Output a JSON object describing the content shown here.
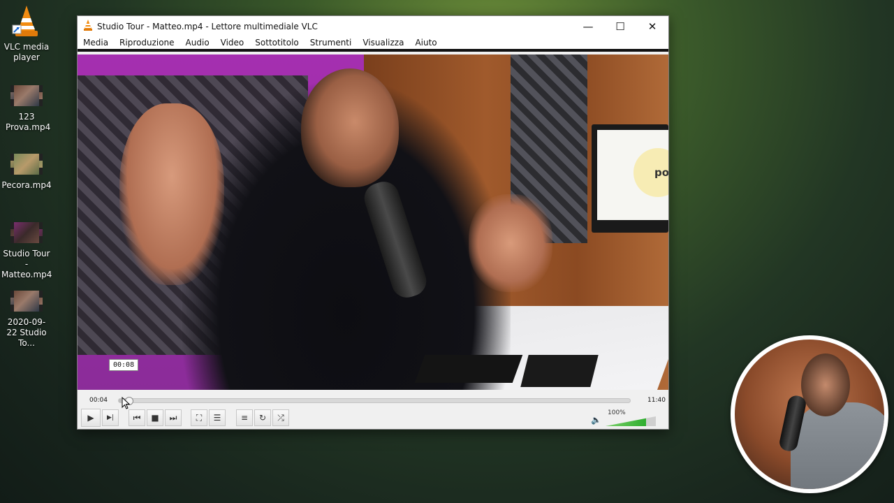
{
  "desktop": {
    "icons": [
      {
        "label": "VLC media player",
        "type": "vlc"
      },
      {
        "label": "123 Prova.mp4",
        "type": "video"
      },
      {
        "label": "Pecora.mp4",
        "type": "video"
      },
      {
        "label": "Studio Tour - Matteo.mp4",
        "type": "video"
      },
      {
        "label": "2020-09-22 Studio To...",
        "type": "video"
      }
    ]
  },
  "window": {
    "title": "Studio Tour - Matteo.mp4 - Lettore multimediale VLC",
    "minimize": "—",
    "maximize": "☐",
    "close": "✕"
  },
  "menu": [
    "Media",
    "Riproduzione",
    "Audio",
    "Video",
    "Sottotitolo",
    "Strumenti",
    "Visualizza",
    "Aiuto"
  ],
  "video": {
    "screen_text": "pod",
    "hover_time": "00:08"
  },
  "player": {
    "elapsed": "00:04",
    "total": "11:40",
    "progress_fraction": 0.006,
    "volume_label": "100%",
    "volume_fraction": 0.8,
    "icons": {
      "play": "▶",
      "frame_step": "▶|",
      "prev": "⏮",
      "stop": "■",
      "next": "⏭",
      "fullscreen": "⛶",
      "extended": "☰",
      "playlist": "≡",
      "loop": "↻",
      "shuffle": "⤮",
      "volume": "🔈"
    }
  }
}
